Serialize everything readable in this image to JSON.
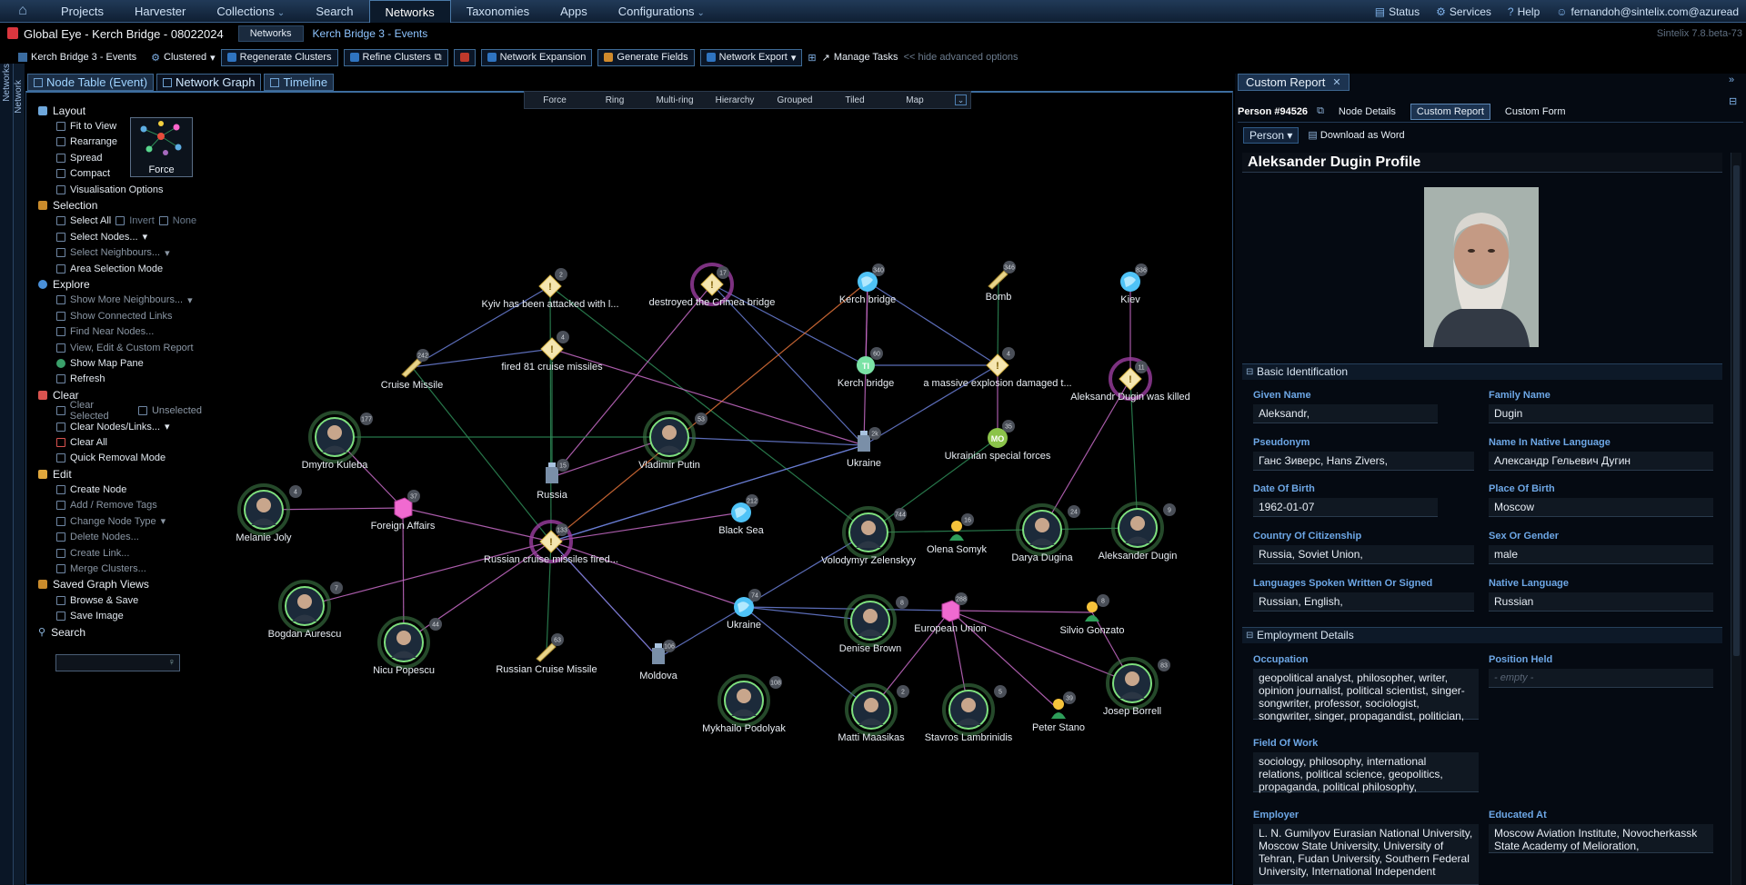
{
  "topnav": {
    "items": [
      {
        "label": "Projects",
        "active": false,
        "dd": false
      },
      {
        "label": "Harvester",
        "active": false,
        "dd": false
      },
      {
        "label": "Collections",
        "active": false,
        "dd": true
      },
      {
        "label": "Search",
        "active": false,
        "dd": false
      },
      {
        "label": "Networks",
        "active": true,
        "dd": false
      },
      {
        "label": "Taxonomies",
        "active": false,
        "dd": false
      },
      {
        "label": "Apps",
        "active": false,
        "dd": false
      },
      {
        "label": "Configurations",
        "active": false,
        "dd": true
      }
    ],
    "status": "Status",
    "services": "Services",
    "help": "Help",
    "user": "fernandoh@sintelix.com@azuread"
  },
  "titlebar": {
    "project": "Global Eye - Kerch Bridge - 08022024",
    "crumb": "Networks",
    "crumb2": "Kerch Bridge 3 - Events",
    "version": "Sintelix 7.8.beta-73"
  },
  "toolbar": {
    "network": "Kerch Bridge 3 - Events",
    "clustered": "Clustered",
    "regen": "Regenerate Clusters",
    "refine": "Refine Clusters",
    "expansion": "Network Expansion",
    "generate": "Generate Fields",
    "export": "Network Export",
    "manage": "Manage Tasks",
    "hide": "<< hide advanced options"
  },
  "rail": {
    "a": "Networks",
    "b": "Network"
  },
  "tabs": {
    "t1": "Node Table (Event)",
    "t2": "Network Graph",
    "t3": "Timeline"
  },
  "layouts": [
    "Force",
    "Ring",
    "Multi-ring",
    "Hierarchy",
    "Grouped",
    "Tiled",
    "Map"
  ],
  "sidebar": {
    "layout": "Layout",
    "fit": "Fit to View",
    "rearrange": "Rearrange",
    "spread": "Spread",
    "compact": "Compact",
    "vis": "Visualisation Options",
    "force": "Force",
    "selection": "Selection",
    "selall": "Select All",
    "invert": "Invert",
    "none": "None",
    "selnodes": "Select Nodes...",
    "selneigh": "Select Neighbours...",
    "area": "Area Selection Mode",
    "explore": "Explore",
    "more": "Show More Neighbours...",
    "connected": "Show Connected Links",
    "near": "Find Near Nodes...",
    "custom": "View, Edit & Custom Report",
    "map": "Show Map Pane",
    "refresh": "Refresh",
    "clear": "Clear",
    "clsel": "Clear Selected",
    "unsel": "Unselected",
    "clnodes": "Clear Nodes/Links...",
    "clall": "Clear All",
    "quick": "Quick Removal Mode",
    "edit": "Edit",
    "create": "Create Node",
    "addtags": "Add / Remove Tags",
    "changetype": "Change Node Type",
    "delete": "Delete Nodes...",
    "clink": "Create Link...",
    "merge": "Merge Clusters...",
    "saved": "Saved Graph Views",
    "browse": "Browse & Save",
    "saveimg": "Save Image",
    "search": "Search"
  },
  "graph": {
    "nodes": [
      {
        "id": "kyiv_att",
        "label": "Kyiv has been attacked with l...",
        "t": "event",
        "c": "2"
      },
      {
        "id": "crimea",
        "label": "destroyed the Crimea bridge",
        "t": "event",
        "c": "17"
      },
      {
        "id": "kb1",
        "label": "Kerch bridge",
        "t": "globe",
        "c": "340"
      },
      {
        "id": "bomb",
        "label": "Bomb",
        "t": "weapon",
        "c": "346"
      },
      {
        "id": "kiev",
        "label": "Kiev",
        "t": "globe",
        "c": "836"
      },
      {
        "id": "cruise",
        "label": "Cruise Missile",
        "t": "weapon",
        "c": "242"
      },
      {
        "id": "fired",
        "label": "fired 81 cruise missiles",
        "t": "event",
        "c": "4"
      },
      {
        "id": "kb2",
        "label": "Kerch bridge",
        "t": "green",
        "c": "60"
      },
      {
        "id": "explosion",
        "label": "a massive explosion damaged t...",
        "t": "event",
        "c": "4"
      },
      {
        "id": "dugin_k",
        "label": "Aleksandr Dugin was killed",
        "t": "event",
        "c": "11"
      },
      {
        "id": "kuleba",
        "label": "Dmytro Kuleba",
        "t": "person",
        "c": "177"
      },
      {
        "id": "putin",
        "label": "Vladimir Putin",
        "t": "person",
        "c": "53"
      },
      {
        "id": "ukr1",
        "label": "Ukraine",
        "t": "flag",
        "c": "2k"
      },
      {
        "id": "usf",
        "label": "Ukrainian special forces",
        "t": "org",
        "c": "35"
      },
      {
        "id": "russia",
        "label": "Russia",
        "t": "flag",
        "c": "15"
      },
      {
        "id": "joly",
        "label": "Melanie Joly",
        "t": "person",
        "c": "4"
      },
      {
        "id": "fa",
        "label": "Foreign Affairs",
        "t": "cube",
        "c": "37"
      },
      {
        "id": "rcm",
        "label": "Russian cruise missiles fired...",
        "t": "event",
        "c": "133"
      },
      {
        "id": "blacksea",
        "label": "Black Sea",
        "t": "globe",
        "c": "212"
      },
      {
        "id": "zelensky",
        "label": "Volodymyr Zelenskyy",
        "t": "person",
        "c": "744"
      },
      {
        "id": "olena",
        "label": "Olena Somyk",
        "t": "pin",
        "c": "16"
      },
      {
        "id": "darya",
        "label": "Darya Dugina",
        "t": "person",
        "c": "24"
      },
      {
        "id": "adugin",
        "label": "Aleksander Dugin",
        "t": "person",
        "c": "9"
      },
      {
        "id": "aurescu",
        "label": "Bogdan Aurescu",
        "t": "person",
        "c": "7"
      },
      {
        "id": "popescu",
        "label": "Nicu Popescu",
        "t": "person",
        "c": "44"
      },
      {
        "id": "rcm2",
        "label": "Russian Cruise Missile",
        "t": "weapon",
        "c": "63"
      },
      {
        "id": "moldova",
        "label": "Moldova",
        "t": "flag",
        "c": "106"
      },
      {
        "id": "ukr2",
        "label": "Ukraine",
        "t": "globe",
        "c": "74"
      },
      {
        "id": "denise",
        "label": "Denise Brown",
        "t": "person",
        "c": "8"
      },
      {
        "id": "eu",
        "label": "European Union",
        "t": "cube",
        "c": "288"
      },
      {
        "id": "silvio",
        "label": "Silvio Gonzato",
        "t": "pin",
        "c": "8"
      },
      {
        "id": "podolyak",
        "label": "Mykhailo Podolyak",
        "t": "person",
        "c": "108"
      },
      {
        "id": "matti",
        "label": "Matti Maasikas",
        "t": "person",
        "c": "2"
      },
      {
        "id": "stavros",
        "label": "Stavros Lambrinidis",
        "t": "person",
        "c": "5"
      },
      {
        "id": "peter",
        "label": "Peter Stano",
        "t": "pin",
        "c": "39"
      },
      {
        "id": "borrell",
        "label": "Josep Borrell",
        "t": "person",
        "c": "83"
      }
    ]
  },
  "report": {
    "tab": "Custom Report",
    "person": "Person #94526",
    "nd": "Node Details",
    "cr": "Custom Report",
    "cf": "Custom Form",
    "type": "Person",
    "word": "Download as Word",
    "title": "Aleksander Dugin Profile",
    "basic": "Basic Identification",
    "given_l": "Given Name",
    "given": "Aleksandr,",
    "family_l": "Family Name",
    "family": "Dugin",
    "pseudo_l": "Pseudonym",
    "pseudo": "Ганс Зиверс, Hans Zivers,",
    "native_l": "Name In Native Language",
    "native": "Александр Гельевич Дугин",
    "dob_l": "Date Of Birth",
    "dob": "1962-01-07",
    "pob_l": "Place Of Birth",
    "pob": "Moscow",
    "cit_l": "Country Of Citizenship",
    "cit": "Russia, Soviet Union,",
    "sex_l": "Sex Or Gender",
    "sex": "male",
    "lang_l": "Languages Spoken Written Or Signed",
    "lang": "Russian, English,",
    "nlang_l": "Native Language",
    "nlang": "Russian",
    "emp": "Employment Details",
    "occ_l": "Occupation",
    "occ": "geopolitical analyst, philosopher, writer, opinion journalist, political scientist, singer-songwriter, professor, sociologist, songwriter, singer, propagandist, politician,",
    "pos_l": "Position Held",
    "pos": "- empty -",
    "fow_l": "Field Of Work",
    "fow": "sociology, philosophy, international relations, political science, geopolitics, propaganda, political philosophy,",
    "employer_l": "Employer",
    "employer": "L. N. Gumilyov Eurasian National University, Moscow State University, University of Tehran, Fudan University, Southern Federal University, International Independent",
    "edu_l": "Educated At",
    "edu": "Moscow Aviation Institute, Novocherkassk State Academy of Melioration,"
  }
}
